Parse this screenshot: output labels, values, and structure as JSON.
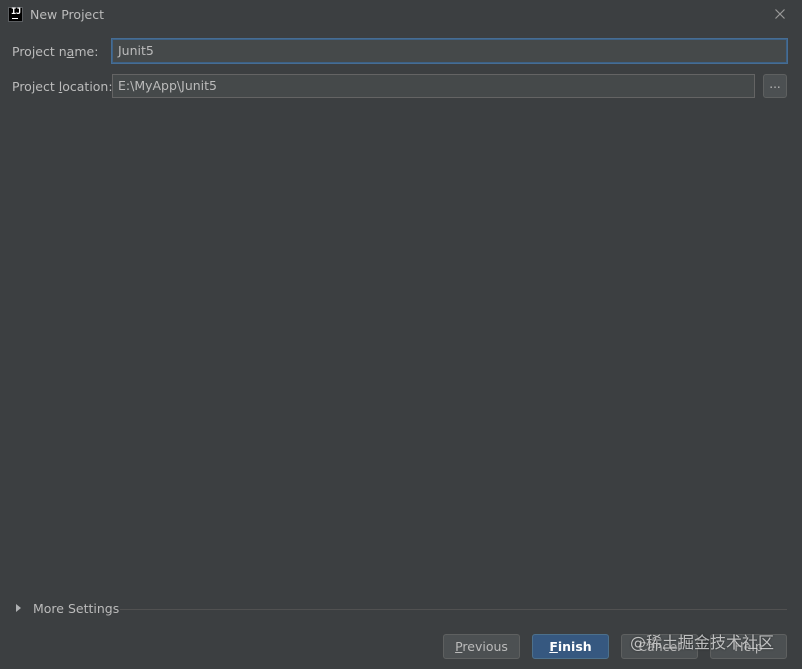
{
  "window": {
    "title": "New Project",
    "app_icon": "intellij-idea-icon",
    "close_icon": "close-icon"
  },
  "form": {
    "project_name": {
      "label_pre": "Project n",
      "label_mnemonic": "a",
      "label_post": "me:",
      "value": "Junit5"
    },
    "project_location": {
      "label_pre": "Project ",
      "label_mnemonic": "l",
      "label_post": "ocation:",
      "value": "E:\\MyApp\\Junit5",
      "browse_label": "..."
    }
  },
  "more_settings": {
    "label_pre": "More",
    "label_mnemonic": "",
    "label_post": " Settings",
    "icon": "triangle-right-icon",
    "expanded": false
  },
  "footer": {
    "previous": {
      "mnemonic": "P",
      "rest": "revious"
    },
    "finish": {
      "mnemonic": "F",
      "rest": "inish"
    },
    "cancel": {
      "label": "Cancel"
    },
    "help": {
      "label": "Help"
    }
  },
  "watermark": "@稀土掘金技术社区",
  "colors": {
    "background": "#3c3f41",
    "field_background": "#45494a",
    "focus_border": "#3d6185",
    "default_button": "#365880",
    "text": "#bbbbbb"
  }
}
